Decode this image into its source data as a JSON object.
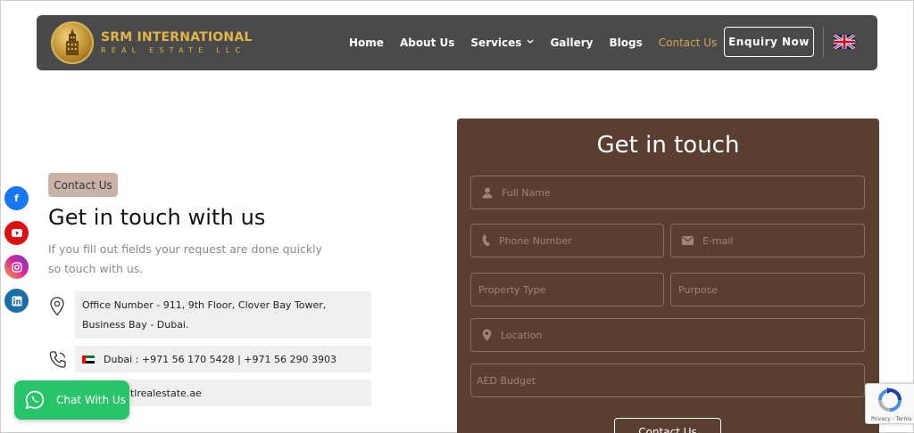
{
  "logo": {
    "title": "SRM INTERNATIONAL",
    "subtitle": "REAL ESTATE LLC"
  },
  "nav": {
    "items": [
      {
        "label": "Home"
      },
      {
        "label": "About Us"
      },
      {
        "label": "Services"
      },
      {
        "label": "Gallery"
      },
      {
        "label": "Blogs"
      },
      {
        "label": "Contact Us"
      }
    ],
    "enquiry_label": "Enquiry Now",
    "language_icon": "uk-flag-icon"
  },
  "contact": {
    "pill": "Contact Us",
    "heading": "Get in touch with us",
    "lead": "If you fill out fields your request are done quickly so touch with us.",
    "office": "Office Number - 911, 9th Floor, Clover Bay Tower, Business Bay - Dubai.",
    "phone": "Dubai : +971 56 170 5428 | +971 56 290 3903",
    "email_visible": "ntlrealestate.ae"
  },
  "social": [
    "facebook-icon",
    "youtube-icon",
    "instagram-icon",
    "linkedin-icon"
  ],
  "whatsapp": {
    "label": "Chat With Us"
  },
  "form": {
    "title": "Get in touch",
    "full_name_ph": "Full Name",
    "phone_ph": "Phone Number",
    "email_ph": "E-mail",
    "property_type_ph": "Property Type",
    "purpose_ph": "Purpose",
    "location_ph": "Location",
    "budget_ph": "AED Budget",
    "submit_label": "Contact Us"
  },
  "recaptcha": {
    "terms": "Privacy - Terms"
  },
  "colors": {
    "nav_bg": "#4a4a4a",
    "accent_gold": "#d4a84a",
    "form_bg": "#5a3e30",
    "whatsapp": "#27c46a"
  }
}
